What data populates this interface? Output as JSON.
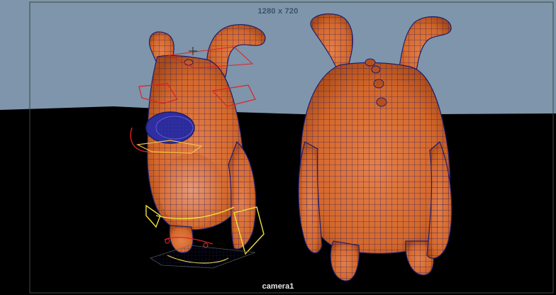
{
  "viewport": {
    "resolution_label": "1280 x 720",
    "camera_label": "camera1"
  },
  "colors": {
    "sky": "#7f95ab",
    "ground": "#000000",
    "body": "#d4682a",
    "wire": "#1e1e6e",
    "controls_red": "#e02020",
    "controls_yellow": "#f0e040",
    "eye": "#3b3bd6"
  },
  "scene": {
    "objects": [
      "character-front-view",
      "character-back-view",
      "rig-controls",
      "ground-plane-grid"
    ]
  }
}
